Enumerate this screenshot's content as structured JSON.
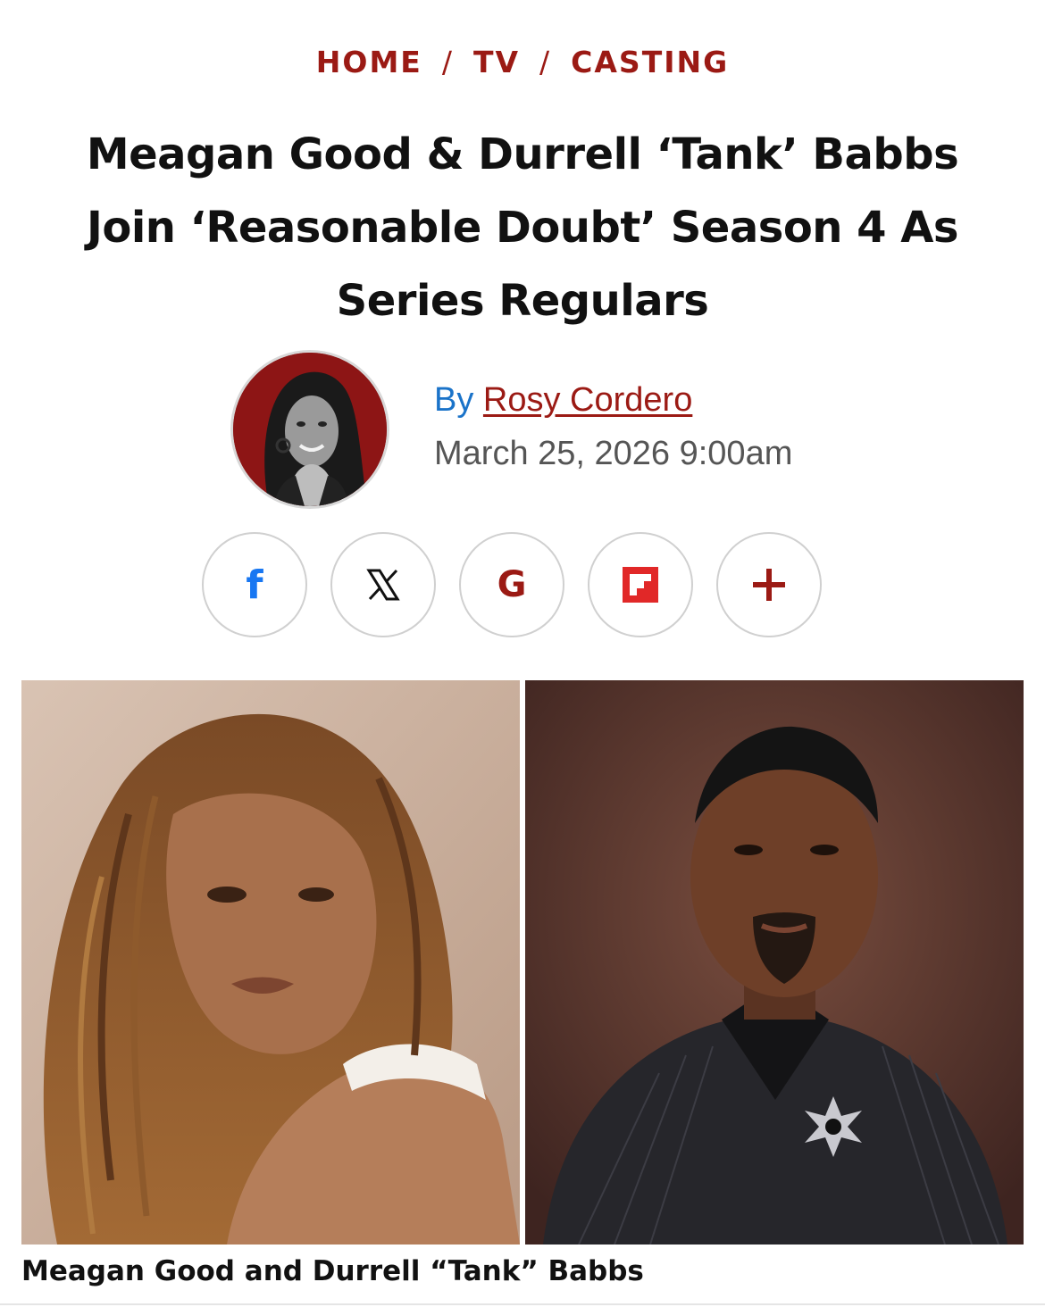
{
  "breadcrumb": {
    "items": [
      {
        "label": "HOME"
      },
      {
        "label": "TV"
      },
      {
        "label": "CASTING"
      }
    ],
    "separator": "/"
  },
  "article": {
    "headline_line1": "Meagan Good & Durrell ‘Tank’ Babbs",
    "headline_line2": "Join ‘Reasonable Doubt’ Season 4 As",
    "headline_line3": "Series Regulars",
    "byline_prefix": "By",
    "author": "Rosy Cordero",
    "date": "March 25, 2026 9:00am",
    "caption": "Meagan Good and Durrell “Tank” Babbs"
  },
  "share": [
    {
      "icon": "facebook-icon",
      "glyph": "f"
    },
    {
      "icon": "x-twitter-icon",
      "glyph": "𝕏"
    },
    {
      "icon": "google-icon",
      "glyph": "G"
    },
    {
      "icon": "flipboard-icon",
      "glyph": ""
    },
    {
      "icon": "more-share-icon",
      "glyph": "+"
    }
  ],
  "colors": {
    "accent": "#9b1a14",
    "byline_blue": "#1a73c9",
    "facebook": "#1877f2",
    "flipboard": "#e12828"
  }
}
